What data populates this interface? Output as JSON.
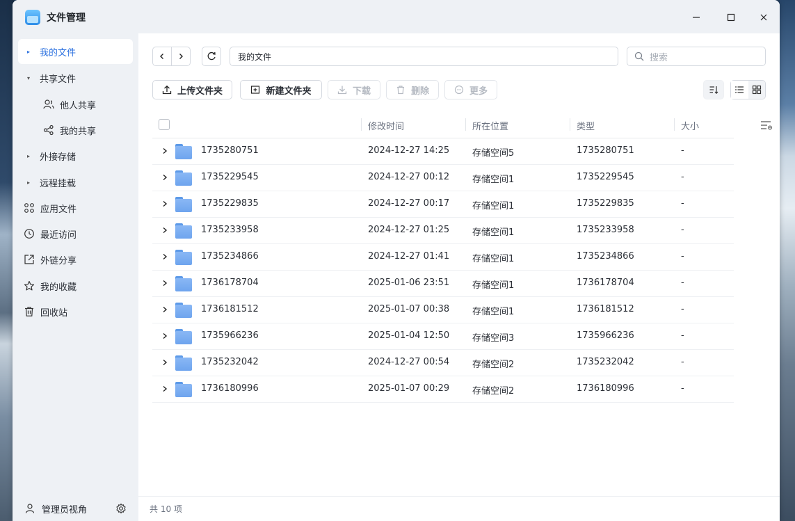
{
  "window": {
    "title": "文件管理",
    "controls": [
      "minimize-icon",
      "maximize-icon",
      "close-icon"
    ]
  },
  "sidebar": {
    "items": [
      {
        "label": "我的文件",
        "icon": "caret-right-icon",
        "active": true
      },
      {
        "label": "共享文件",
        "icon": "caret-down-icon",
        "active": false
      },
      {
        "label": "他人共享",
        "icon": "users-icon",
        "active": false
      },
      {
        "label": "我的共享",
        "icon": "share-icon",
        "active": false
      },
      {
        "label": "外接存储",
        "icon": "caret-right-icon",
        "active": false
      },
      {
        "label": "远程挂载",
        "icon": "caret-right-icon",
        "active": false
      },
      {
        "label": "应用文件",
        "icon": "apps-icon",
        "active": false
      },
      {
        "label": "最近访问",
        "icon": "clock-icon",
        "active": false
      },
      {
        "label": "外链分享",
        "icon": "external-link-icon",
        "active": false
      },
      {
        "label": "我的收藏",
        "icon": "star-icon",
        "active": false
      },
      {
        "label": "回收站",
        "icon": "trash-icon",
        "active": false
      }
    ],
    "footer": {
      "label": "管理员视角",
      "icon": "user-icon",
      "settings_icon": "gear-icon"
    }
  },
  "toolbar": {
    "path": "我的文件",
    "search_placeholder": "搜索",
    "actions": {
      "upload": "上传文件夹",
      "new_folder": "新建文件夹",
      "download": "下载",
      "delete": "删除",
      "more": "更多"
    }
  },
  "table": {
    "columns": {
      "time": "修改时间",
      "location": "所在位置",
      "type": "类型",
      "size": "大小"
    },
    "rows": [
      {
        "name": "1735280751",
        "time": "2024-12-27 14:25",
        "location": "存储空间5",
        "type": "1735280751",
        "size": "-"
      },
      {
        "name": "1735229545",
        "time": "2024-12-27 00:12",
        "location": "存储空间1",
        "type": "1735229545",
        "size": "-"
      },
      {
        "name": "1735229835",
        "time": "2024-12-27 00:17",
        "location": "存储空间1",
        "type": "1735229835",
        "size": "-"
      },
      {
        "name": "1735233958",
        "time": "2024-12-27 01:25",
        "location": "存储空间1",
        "type": "1735233958",
        "size": "-"
      },
      {
        "name": "1735234866",
        "time": "2024-12-27 01:41",
        "location": "存储空间1",
        "type": "1735234866",
        "size": "-"
      },
      {
        "name": "1736178704",
        "time": "2025-01-06 23:51",
        "location": "存储空间1",
        "type": "1736178704",
        "size": "-"
      },
      {
        "name": "1736181512",
        "time": "2025-01-07 00:38",
        "location": "存储空间1",
        "type": "1736181512",
        "size": "-"
      },
      {
        "name": "1735966236",
        "time": "2025-01-04 12:50",
        "location": "存储空间3",
        "type": "1735966236",
        "size": "-"
      },
      {
        "name": "1735232042",
        "time": "2024-12-27 00:54",
        "location": "存储空间2",
        "type": "1735232042",
        "size": "-"
      },
      {
        "name": "1736180996",
        "time": "2025-01-07 00:29",
        "location": "存储空间2",
        "type": "1736180996",
        "size": "-"
      }
    ]
  },
  "status": {
    "count_text": "共 10 项"
  },
  "colors": {
    "accent": "#2f73e0",
    "sidebar_bg": "#eef1f5",
    "folder": "#6ea4ee"
  }
}
